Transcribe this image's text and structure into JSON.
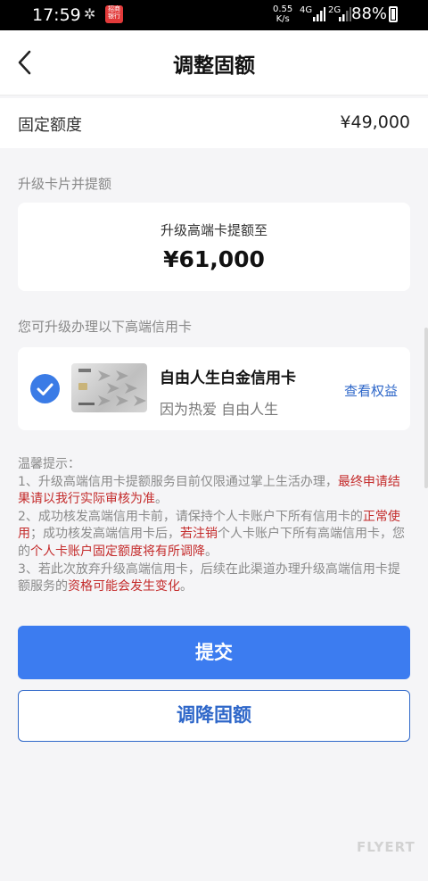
{
  "status_bar": {
    "time": "17:59",
    "app_badge": "招商银行",
    "net_speed_value": "0.55",
    "net_speed_unit": "K/s",
    "net_4g": "4G",
    "net_2g": "2G",
    "battery": "88%"
  },
  "header": {
    "title": "调整固额",
    "back_icon": "chevron-left-icon"
  },
  "fixed_quota": {
    "label": "固定额度",
    "value": "¥49,000"
  },
  "upgrade_section": {
    "title": "升级卡片并提额",
    "subtitle": "升级高端卡提额至",
    "amount": "¥61,000"
  },
  "card_section": {
    "title": "您可升级办理以下高端信用卡",
    "card_name": "自由人生白金信用卡",
    "card_slogan": "因为热爱 自由人生",
    "link_label": "查看权益",
    "selected": true
  },
  "tips": {
    "title": "温馨提示：",
    "item1_a": "1、升级高端信用卡提额服务目前仅限通过掌上生活办理，",
    "item1_red": "最终申请结果请以我行实际审核为准",
    "item1_b": "。",
    "item2_a": "2、成功核发高端信用卡前，请保持个人卡账户下所有信用卡的",
    "item2_red1": "正常使用",
    "item2_b": "；成功核发高端信用卡后，",
    "item2_red2": "若注销",
    "item2_c": "个人卡账户下所有高端信用卡，您的",
    "item2_red3": "个人卡账户固定额度将有所调降",
    "item2_d": "。",
    "item3_a": "3、若此次放弃升级高端信用卡，后续在此渠道办理升级高端信用卡提额服务的",
    "item3_red": "资格可能会发生变化",
    "item3_b": "。"
  },
  "buttons": {
    "submit": "提交",
    "lower": "调降固额"
  },
  "watermark": "FLYERT",
  "colors": {
    "accent": "#3c7cf0",
    "link": "#2e67c9",
    "warning_red": "#c42b2b",
    "background": "#f5f5f7"
  }
}
